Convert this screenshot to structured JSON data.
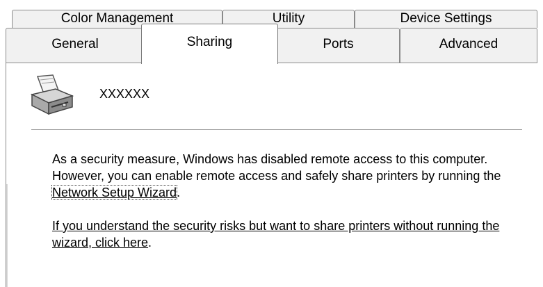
{
  "tabs_row_back": [
    {
      "label": "Color Management"
    },
    {
      "label": "Utility"
    },
    {
      "label": "Device Settings"
    }
  ],
  "tabs_row_front": [
    {
      "label": "General"
    },
    {
      "label": "Sharing",
      "selected": true
    },
    {
      "label": "Ports"
    },
    {
      "label": "Advanced"
    }
  ],
  "printer": {
    "icon": "printer-icon",
    "name": "XXXXXX"
  },
  "sharing": {
    "message_part1": "As a security measure, Windows has disabled remote access to this computer. However, you can enable remote access and safely share printers by running the ",
    "wizard_link": "Network Setup Wizard",
    "message_part2": ".",
    "override_link": "If you understand the security risks but want to share printers without running the wizard, click here",
    "override_end": "."
  }
}
